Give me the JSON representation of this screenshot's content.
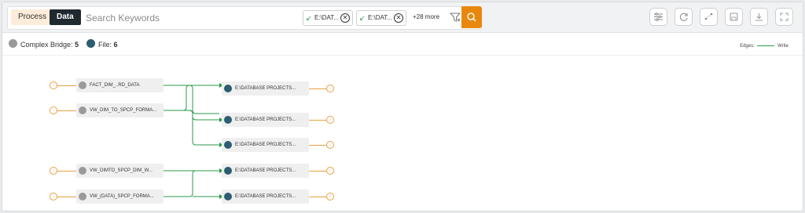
{
  "search": {
    "process_label": "Process",
    "data_label": "Data",
    "placeholder": "Search Keywords",
    "chips": [
      {
        "label": "E:\\DAT..."
      },
      {
        "label": "E:\\DAT..."
      }
    ],
    "more_label": "+28 more"
  },
  "toolbar": {
    "icons": [
      "filter-settings-icon",
      "refresh-icon",
      "layout-icon",
      "save-icon",
      "download-icon",
      "fullscreen-icon"
    ]
  },
  "summary": {
    "complex_bridge_label": "Complex Bridge:",
    "complex_bridge_count": "5",
    "file_label": "File:",
    "file_count": "6"
  },
  "legend": {
    "edges_label": "Edges:",
    "write_label": "Write"
  },
  "graph": {
    "sources": [
      {
        "label": "FACT_DIM_..RD_DATA"
      },
      {
        "label": "VW_DIM_TO_SPCP_FORMA..."
      },
      {
        "label": "VW_DIMTO_SPCP_DIM_W..."
      },
      {
        "label": "VW_(DATA)_SPCP_FORMA..."
      }
    ],
    "targets": [
      {
        "label": "E:\\DATABASE PROJECTS..."
      },
      {
        "label": "E:\\DATABASE PROJECTS..."
      },
      {
        "label": "E:\\DATABASE PROJECTS..."
      },
      {
        "label": "E:\\DATABASE PROJECTS..."
      },
      {
        "label": "E:\\DATABASE PROJECTS..."
      }
    ]
  },
  "colors": {
    "accent": "#e8870e",
    "edge_green": "#2a9a4a",
    "bridge_grey": "#9a9a9a",
    "file_teal": "#2c5d73",
    "expander_orange": "#e8a040"
  }
}
